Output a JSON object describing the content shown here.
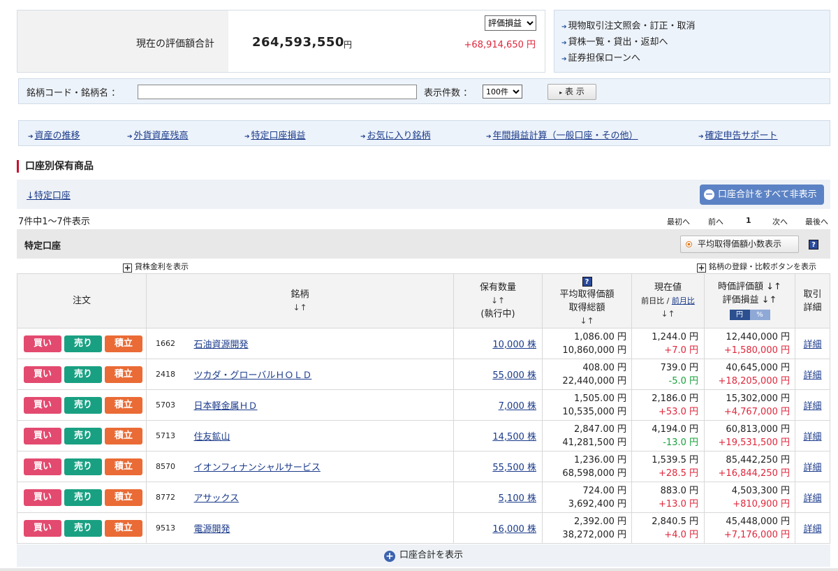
{
  "summary": {
    "label": "現在の評価額合計",
    "total": "264,593,550",
    "unit": "円",
    "diff": "+68,914,650 円",
    "select_value": "評価損益"
  },
  "quick_links": [
    "現物取引注文照会・訂正・取消",
    "貸株一覧・貸出・返却へ",
    "証券担保ローンへ"
  ],
  "search": {
    "label": "銘柄コード・銘柄名 ：",
    "count_label": "表示件数 ：",
    "count_value": "100件",
    "button": "表 示"
  },
  "nav": [
    "資産の推移",
    "外貨資産残高",
    "特定口座損益",
    "お気に入り銘柄",
    "年間損益計算（一般口座・その他）",
    "確定申告サポート"
  ],
  "section_title": "口座別保有商品",
  "account_link": "↓特定口座",
  "hide_button": "口座合計をすべて非表示",
  "count_text": "7件中1～7件表示",
  "pager": {
    "first": "最初へ",
    "prev": "前へ",
    "page": "1",
    "next": "次へ",
    "last": "最後へ"
  },
  "account_bar": {
    "title": "特定口座",
    "avg_button": "平均取得価額小数表示",
    "help": "?"
  },
  "expand_left": "貸株金利を表示",
  "expand_right": "銘柄の登録・比較ボタンを表示",
  "table": {
    "headers": {
      "order": "注文",
      "name": "銘柄",
      "name_sort": "↓↑",
      "qty": "保有数量",
      "qty_sort": "↓↑",
      "qty_sub": "(執行中)",
      "avg_help": "?",
      "avg": "平均取得価額",
      "avg2": "取得総額",
      "avg_sort": "↓↑",
      "cur": "現在値",
      "cur_sub1": "前日比",
      "cur_sep": " / ",
      "cur_sub2": "前月比",
      "cur_sort": "↓↑",
      "val": "時価評価額 ↓↑",
      "val2": "評価損益 ↓↑",
      "toggle_yen": "円",
      "toggle_pct": "%",
      "det1": "取引",
      "det2": "詳細"
    },
    "buttons": {
      "buy": "買い",
      "sell": "売り",
      "save": "積立"
    },
    "rows": [
      {
        "code": "1662",
        "name": "石油資源開発",
        "qty": "10,000 株",
        "avg": "1,086.00 円",
        "cost": "10,860,000 円",
        "price": "1,244.0 円",
        "change": "+7.0 円",
        "change_sign": "pos",
        "value": "12,440,000 円",
        "pl": "+1,580,000 円",
        "detail": "詳細"
      },
      {
        "code": "2418",
        "name": "ツカダ・グローバルＨＯＬＤ",
        "qty": "55,000 株",
        "avg": "408.00 円",
        "cost": "22,440,000 円",
        "price": "739.0 円",
        "change": "-5.0 円",
        "change_sign": "neg",
        "value": "40,645,000 円",
        "pl": "+18,205,000 円",
        "detail": "詳細"
      },
      {
        "code": "5703",
        "name": "日本軽金属ＨＤ",
        "qty": "7,000 株",
        "avg": "1,505.00 円",
        "cost": "10,535,000 円",
        "price": "2,186.0 円",
        "change": "+53.0 円",
        "change_sign": "pos",
        "value": "15,302,000 円",
        "pl": "+4,767,000 円",
        "detail": "詳細"
      },
      {
        "code": "5713",
        "name": "住友鉱山",
        "qty": "14,500 株",
        "avg": "2,847.00 円",
        "cost": "41,281,500 円",
        "price": "4,194.0 円",
        "change": "-13.0 円",
        "change_sign": "neg",
        "value": "60,813,000 円",
        "pl": "+19,531,500 円",
        "detail": "詳細"
      },
      {
        "code": "8570",
        "name": "イオンフィナンシャルサービス",
        "qty": "55,500 株",
        "avg": "1,236.00 円",
        "cost": "68,598,000 円",
        "price": "1,539.5 円",
        "change": "+28.5 円",
        "change_sign": "pos",
        "value": "85,442,250 円",
        "pl": "+16,844,250 円",
        "detail": "詳細"
      },
      {
        "code": "8772",
        "name": "アサックス",
        "qty": "5,100 株",
        "avg": "724.00 円",
        "cost": "3,692,400 円",
        "price": "883.0 円",
        "change": "+13.0 円",
        "change_sign": "pos",
        "value": "4,503,300 円",
        "pl": "+810,900 円",
        "detail": "詳細"
      },
      {
        "code": "9513",
        "name": "電源開発",
        "qty": "16,000 株",
        "avg": "2,392.00 円",
        "cost": "38,272,000 円",
        "price": "2,840.5 円",
        "change": "+4.0 円",
        "change_sign": "pos",
        "value": "45,448,000 円",
        "pl": "+7,176,000 円",
        "detail": "詳細"
      }
    ]
  },
  "footer": "口座合計を表示"
}
